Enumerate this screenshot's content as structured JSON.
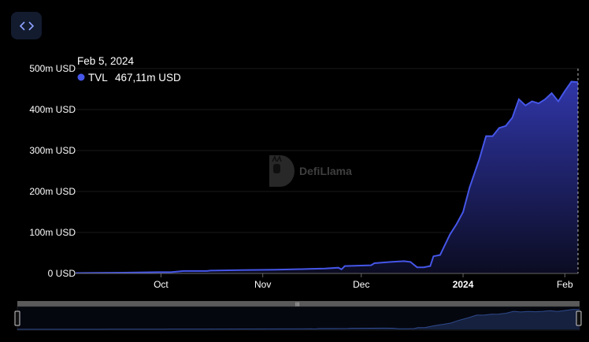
{
  "embed_button": {
    "icon": "code-brackets-icon"
  },
  "watermark": {
    "text": "DefiLlama",
    "icon": "llama-logo-icon"
  },
  "tooltip": {
    "date": "Feb 5, 2024",
    "series_label": "TVL",
    "value": "467,11m USD",
    "marker_color": "#4556e8"
  },
  "colors": {
    "line": "#4556e8",
    "fill_top": "#3036a8",
    "fill_bottom": "#0b0c22",
    "grid": "#1a1a1a",
    "axis_text": "#ffffff"
  },
  "chart_data": {
    "type": "area",
    "title": "",
    "xlabel": "",
    "ylabel": "",
    "ylim": [
      0,
      500
    ],
    "y_unit": "m USD",
    "y_ticks": [
      {
        "value": 0,
        "label": "0 USD"
      },
      {
        "value": 100,
        "label": "100m USD"
      },
      {
        "value": 200,
        "label": "200m USD"
      },
      {
        "value": 300,
        "label": "300m USD"
      },
      {
        "value": 400,
        "label": "400m USD"
      },
      {
        "value": 500,
        "label": "500m USD"
      }
    ],
    "x_ticks": [
      {
        "date": "2023-10-01",
        "label": "Oct",
        "bold": false
      },
      {
        "date": "2023-11-01",
        "label": "Nov",
        "bold": false
      },
      {
        "date": "2023-12-01",
        "label": "Dec",
        "bold": false
      },
      {
        "date": "2024-01-01",
        "label": "2024",
        "bold": true
      },
      {
        "date": "2024-02-01",
        "label": "Feb",
        "bold": false
      }
    ],
    "xlim": [
      "2023-09-05",
      "2024-02-05"
    ],
    "grid": true,
    "series": [
      {
        "name": "TVL",
        "points": [
          [
            "2023-09-05",
            1
          ],
          [
            "2023-09-20",
            2
          ],
          [
            "2023-09-30",
            3
          ],
          [
            "2023-10-04",
            3
          ],
          [
            "2023-10-08",
            6
          ],
          [
            "2023-10-15",
            6
          ],
          [
            "2023-10-16",
            7
          ],
          [
            "2023-10-25",
            8
          ],
          [
            "2023-11-05",
            9
          ],
          [
            "2023-11-15",
            11
          ],
          [
            "2023-11-20",
            12
          ],
          [
            "2023-11-24",
            14
          ],
          [
            "2023-11-25",
            10
          ],
          [
            "2023-11-26",
            18
          ],
          [
            "2023-11-30",
            19
          ],
          [
            "2023-12-04",
            20
          ],
          [
            "2023-12-05",
            25
          ],
          [
            "2023-12-10",
            28
          ],
          [
            "2023-12-14",
            30
          ],
          [
            "2023-12-16",
            28
          ],
          [
            "2023-12-18",
            15
          ],
          [
            "2023-12-20",
            15
          ],
          [
            "2023-12-22",
            18
          ],
          [
            "2023-12-23",
            42
          ],
          [
            "2023-12-25",
            45
          ],
          [
            "2023-12-28",
            95
          ],
          [
            "2023-12-30",
            120
          ],
          [
            "2024-01-01",
            150
          ],
          [
            "2024-01-03",
            210
          ],
          [
            "2024-01-06",
            280
          ],
          [
            "2024-01-08",
            335
          ],
          [
            "2024-01-10",
            335
          ],
          [
            "2024-01-12",
            355
          ],
          [
            "2024-01-14",
            360
          ],
          [
            "2024-01-16",
            380
          ],
          [
            "2024-01-18",
            425
          ],
          [
            "2024-01-20",
            410
          ],
          [
            "2024-01-22",
            420
          ],
          [
            "2024-01-24",
            415
          ],
          [
            "2024-01-26",
            425
          ],
          [
            "2024-01-28",
            440
          ],
          [
            "2024-01-30",
            420
          ],
          [
            "2024-02-01",
            445
          ],
          [
            "2024-02-03",
            468
          ],
          [
            "2024-02-05",
            467
          ]
        ]
      }
    ]
  }
}
